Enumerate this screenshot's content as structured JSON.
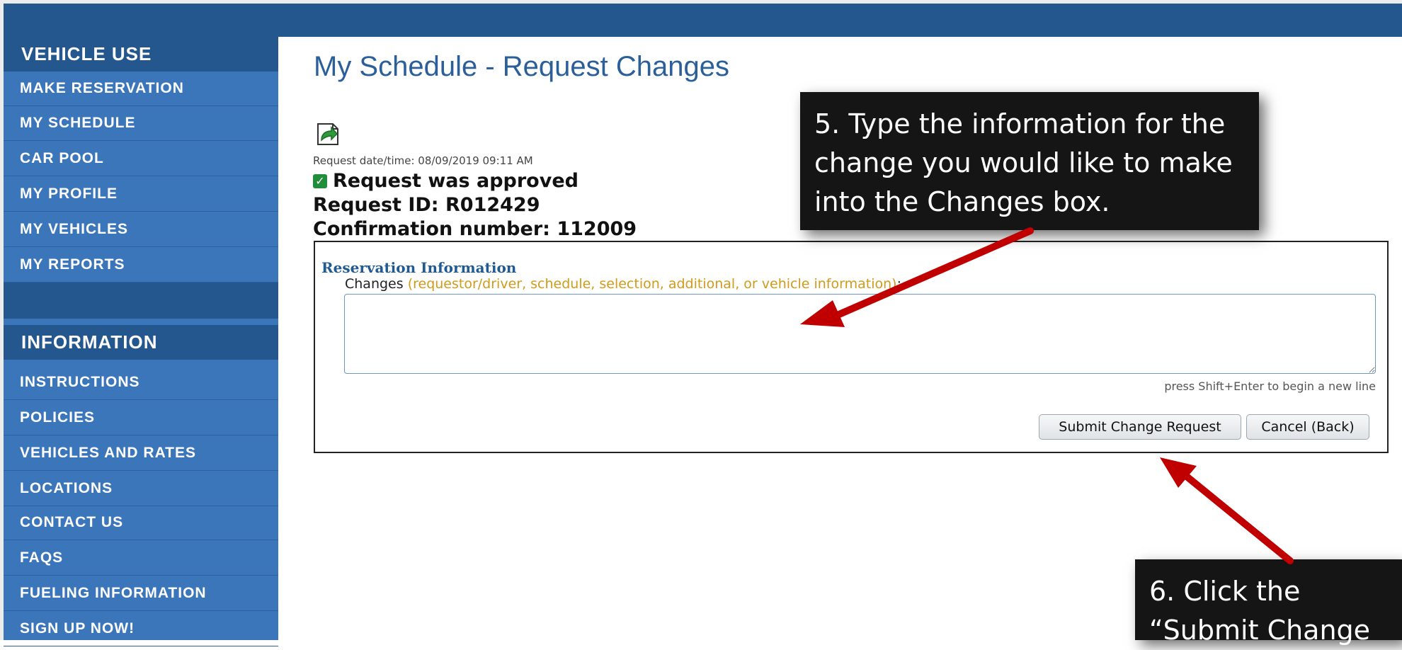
{
  "sidebar": {
    "section1": "VEHICLE USE",
    "section1_items": [
      "MAKE RESERVATION",
      "MY SCHEDULE",
      "CAR POOL",
      "MY PROFILE",
      "MY VEHICLES",
      "MY REPORTS"
    ],
    "section2": "INFORMATION",
    "section2_items": [
      "INSTRUCTIONS",
      "POLICIES",
      "VEHICLES AND RATES",
      "LOCATIONS",
      "CONTACT US",
      "FAQS",
      "FUELING INFORMATION",
      "SIGN UP NOW!"
    ]
  },
  "main": {
    "title": "My Schedule - Request Changes",
    "request_datetime": "Request date/time: 08/09/2019 09:11 AM",
    "status": "Request was approved",
    "request_id": "Request ID: R012429",
    "confirmation": "Confirmation number: 112009",
    "panel_title": "Reservation Information",
    "changes_label": "Changes",
    "changes_hint": "(requestor/driver, schedule, selection, additional, or vehicle information)",
    "changes_colon": ":",
    "changes_value": "",
    "shift_hint": "press Shift+Enter to begin a new line",
    "submit_label": "Submit Change Request",
    "cancel_label": "Cancel (Back)"
  },
  "callouts": {
    "step5": "5.  Type the information for the change you would like to make into the Changes box.",
    "step6": "6.  Click the “Submit Change"
  },
  "colors": {
    "nav_dark": "#25578f",
    "nav_light": "#3b76bb",
    "title_blue": "#2b5f99",
    "arrow_red": "#c00000"
  },
  "icons": {
    "request": "document-arrow-icon",
    "status": "check-icon"
  }
}
